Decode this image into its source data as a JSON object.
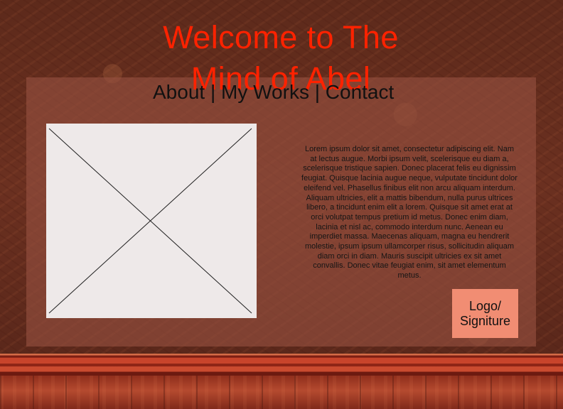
{
  "header": {
    "title": "Welcome to The Mind of Abel"
  },
  "navigation": {
    "items": [
      "About",
      "My Works",
      "Contact"
    ],
    "separator": "|"
  },
  "main": {
    "image_placeholder": "image-placeholder",
    "description": "Lorem ipsum dolor sit amet, consectetur adipiscing elit. Nam at lectus augue. Morbi ipsum velit, scelerisque eu diam a, scelerisque tristique sapien. Donec placerat felis eu dignissim feugiat. Quisque lacinia augue neque, vulputate tincidunt dolor eleifend vel. Phasellus finibus elit non arcu aliquam interdum. Aliquam ultricies, elit a mattis bibendum, nulla purus ultrices libero, a tincidunt enim elit a lorem. Quisque sit amet erat at orci volutpat tempus pretium id metus. Donec enim diam, lacinia et nisl ac, commodo interdum nunc. Aenean eu imperdiet massa. Maecenas aliquam, magna eu hendrerit molestie, ipsum ipsum ullamcorper risus, sollicitudin aliquam diam orci in diam. Mauris suscipit ultricies ex sit amet convallis. Donec vitae feugiat enim, sit amet elementum metus.",
    "signature_box": "Logo/\nSigniture"
  },
  "colors": {
    "title": "#ff2200",
    "panel": "#965140",
    "signature_box": "#f18d73",
    "placeholder": "#eee9e9"
  }
}
